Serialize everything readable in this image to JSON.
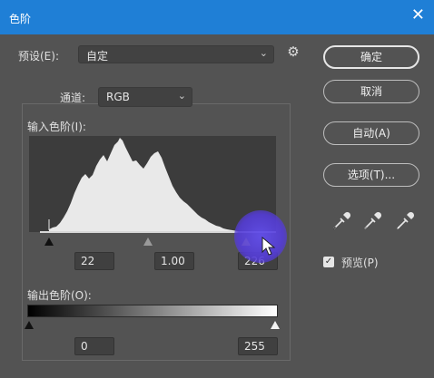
{
  "window": {
    "title": "色阶",
    "close_glyph": "✕"
  },
  "preset": {
    "label": "预设(E):",
    "value": "自定",
    "options_icon": "gear-icon"
  },
  "channel": {
    "label": "通道:",
    "value": "RGB"
  },
  "input_levels": {
    "label": "输入色阶(I):",
    "black": "22",
    "gamma": "1.00",
    "white": "226"
  },
  "output_levels": {
    "label": "输出色阶(O):",
    "black": "0",
    "white": "255"
  },
  "buttons": {
    "ok": "确定",
    "cancel": "取消",
    "auto": "自动(A)",
    "options": "选项(T)..."
  },
  "eyedroppers": [
    "black-eyedropper-icon",
    "gray-eyedropper-icon",
    "white-eyedropper-icon"
  ],
  "preview": {
    "label": "预览(P)",
    "checked": true
  },
  "colors": {
    "titlebar": "#1f7fd6",
    "panel": "#535353",
    "histogram_fill": "#e9e9e9",
    "white_point_handle": "#f2e24c",
    "cursor_highlight": "#5a44e0"
  }
}
